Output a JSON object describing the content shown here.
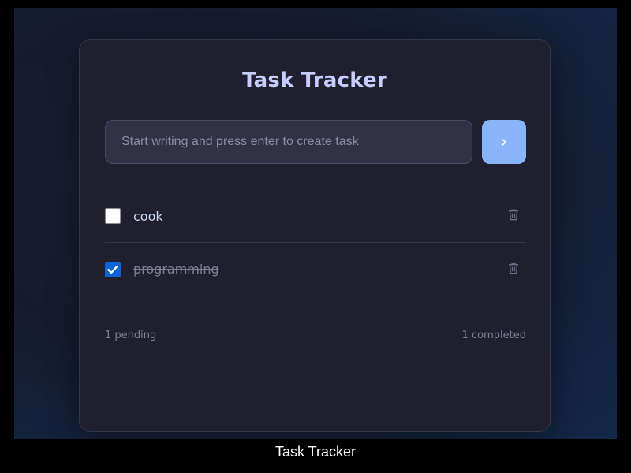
{
  "app": {
    "title": "Task Tracker"
  },
  "input": {
    "placeholder": "Start writing and press enter to create task",
    "value": ""
  },
  "add_button": {
    "icon": "chevron-right-icon",
    "label": "›"
  },
  "tasks": [
    {
      "label": "cook",
      "completed": false,
      "delete_icon": "trash-icon"
    },
    {
      "label": "programming",
      "completed": true,
      "delete_icon": "trash-icon"
    }
  ],
  "footer": {
    "pending": "1 pending",
    "completed": "1 completed"
  },
  "caption": "Task Tracker",
  "colors": {
    "accent": "#89b4fa",
    "title": "#c7cdff",
    "card": "#1f1f2d",
    "checkbox_checked": "#0a66d8"
  }
}
